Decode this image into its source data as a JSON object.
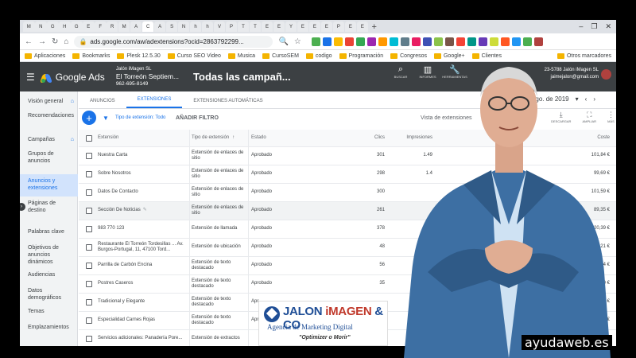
{
  "browser": {
    "tab_letters": [
      "M",
      "N",
      "G",
      "H",
      "G",
      "E",
      "F",
      "R",
      "M",
      "A",
      "C",
      "A",
      "S",
      "N",
      "h",
      "h",
      "V",
      "P",
      "T",
      "T",
      "E",
      "E",
      "Y",
      "E",
      "E",
      "E",
      "P",
      "E",
      "E"
    ],
    "url": "ads.google.com/aw/adextensions?ocid=2863792299...",
    "bookmarks": [
      "Aplicaciones",
      "Bookmarks",
      "Plesk 12.5.30",
      "Curso SEO Video",
      "Musica",
      "CursoSEM",
      "codigo",
      "Programación",
      "Congresos",
      "Google+",
      "Clientes"
    ],
    "other_bookmarks": "Otros marcadores"
  },
  "ads_header": {
    "product": "Google Ads",
    "account_owner": "Jalón iMagen SL",
    "account_name": "El Torreón Septiem...",
    "account_phone": "962-695-8149",
    "campaign": "Todas las campañ...",
    "tools": [
      {
        "icon": "search-icon",
        "label": "BUSCAR"
      },
      {
        "icon": "chart-icon",
        "label": "INFORMES"
      },
      {
        "icon": "wrench-icon",
        "label": "HERRAMIENTAS"
      }
    ],
    "customer_id": "23-5788 Jalón iMagen SL",
    "email": "jaimejalon@gmail.com"
  },
  "sidebar": {
    "items": [
      {
        "label": "Visión general",
        "icon": "home-icon"
      },
      {
        "label": "Recomendaciones",
        "icon": ""
      },
      {
        "label": "Campañas",
        "icon": "home-icon"
      },
      {
        "label": "Grupos de anuncios",
        "icon": ""
      },
      {
        "label": "Anuncios y extensiones",
        "icon": ""
      },
      {
        "label": "Páginas de destino",
        "icon": ""
      },
      {
        "label": "Palabras clave",
        "icon": ""
      },
      {
        "label": "Objetivos de anuncios dinámicos",
        "icon": ""
      },
      {
        "label": "Audiencias",
        "icon": ""
      },
      {
        "label": "Datos demográficos",
        "icon": ""
      },
      {
        "label": "Temas",
        "icon": ""
      },
      {
        "label": "Emplazamientos",
        "icon": ""
      }
    ]
  },
  "tabs": [
    "ANUNCIOS",
    "EXTENSIONES",
    "EXTENSIONES AUTOMÁTICAS"
  ],
  "date_range": "15 ago. de 2019",
  "filter": {
    "label": "Tipo de extensión: Todo",
    "add": "AÑADIR FILTRO",
    "view": "Vista de extensiones"
  },
  "table_tools": [
    {
      "icon": "download-icon",
      "label": "DESCARGAR"
    },
    {
      "icon": "expand-icon",
      "label": "AMPLIAR"
    },
    {
      "icon": "more-icon",
      "label": "MÁS"
    }
  ],
  "table": {
    "headers": {
      "extension": "Extensión",
      "type": "Tipo de extensión",
      "status": "Estado",
      "clicks": "Clics",
      "impressions": "Impresiones",
      "cost": "Coste"
    },
    "rows": [
      {
        "extension": "Nuestra Carta",
        "type": "Extensión de enlaces de sitio",
        "status": "Aprobado",
        "clicks": "301",
        "impressions": "1.49",
        "cost": "101,84 €"
      },
      {
        "extension": "Sobre Nosotros",
        "type": "Extensión de enlaces de sitio",
        "status": "Aprobado",
        "clicks": "298",
        "impressions": "1.4",
        "cost": "99,69 €"
      },
      {
        "extension": "Datos De Contacto",
        "type": "Extensión de enlaces de sitio",
        "status": "Aprobado",
        "clicks": "300",
        "impressions": "",
        "cost": "101,59 €"
      },
      {
        "extension": "Sección De Noticias",
        "type": "Extensión de enlaces de sitio",
        "status": "Aprobado",
        "clicks": "261",
        "impressions": "",
        "cost": "89,35 €"
      },
      {
        "extension": "983 770 123",
        "type": "Extensión de llamada",
        "status": "Aprobado",
        "clicks": "378",
        "impressions": "",
        "cost": "120,39 €"
      },
      {
        "extension": "Restaurante El Torreón Tordesillas ... Av. Burgos-Portugal, 11, 47100 Tord...",
        "type": "Extensión de ubicación",
        "status": "Aprobado",
        "clicks": "48",
        "impressions": "",
        "cost": "12,21 €"
      },
      {
        "extension": "Parrilla de Carbón Encina",
        "type": "Extensión de texto destacado",
        "status": "Aprobado",
        "clicks": "56",
        "impressions": "",
        "cost": "14,44 €"
      },
      {
        "extension": "Postres Caseros",
        "type": "Extensión de texto destacado",
        "status": "Aprobado",
        "clicks": "35",
        "impressions": "183",
        "cost": "10,20 €"
      },
      {
        "extension": "Tradicional y Elegante",
        "type": "Extensión de texto destacado",
        "status": "Apr",
        "clicks": "",
        "impressions": "319",
        "cost": "15,90 €"
      },
      {
        "extension": "Especialidad Carnes Rojas",
        "type": "Extensión de texto destacado",
        "status": "Apr",
        "clicks": "",
        "impressions": "3",
        "cost": "15,76 €"
      },
      {
        "extension": "Servicios adicionales: Panadería Pore...",
        "type": "Extensión de extractos",
        "status": "",
        "clicks": "",
        "impressions": "",
        "cost": "32,15 €"
      }
    ]
  },
  "overlay": {
    "logo_name_1": "JALON ",
    "logo_name_2": "iMAGEN",
    "logo_name_3": " & CO",
    "logo_subtitle": "Agencia de Marketing Digital",
    "logo_tagline": "\"Optimizer o Morir\"",
    "watermark": "ayudaweb.es"
  },
  "colors": {
    "accent": "#1a73e8",
    "header": "#3c4043",
    "brand_blue": "#1f4e96"
  }
}
